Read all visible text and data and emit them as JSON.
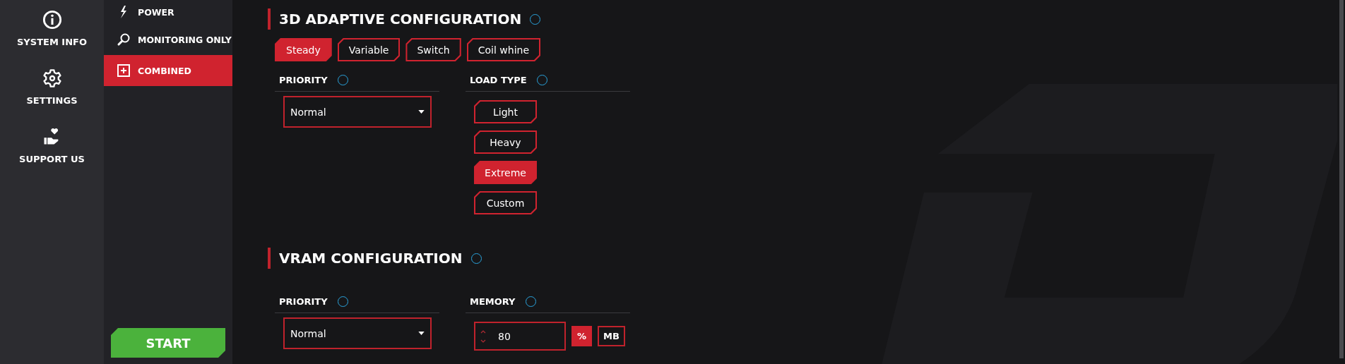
{
  "main_nav": [
    {
      "label": "SYSTEM INFO",
      "kind": "info"
    },
    {
      "label": "SETTINGS",
      "kind": "gear"
    },
    {
      "label": "SUPPORT US",
      "kind": "heart"
    }
  ],
  "test_nav": {
    "items": [
      {
        "label": "POWER",
        "kind": "bolt",
        "selected": false
      },
      {
        "label": "MONITORING ONLY",
        "kind": "search",
        "selected": false
      },
      {
        "label": "COMBINED",
        "kind": "plus",
        "selected": true
      }
    ],
    "start_button": "START"
  },
  "adaptive": {
    "title": "3D ADAPTIVE CONFIGURATION",
    "modes": [
      {
        "label": "Steady",
        "selected": true
      },
      {
        "label": "Variable",
        "selected": false
      },
      {
        "label": "Switch",
        "selected": false
      },
      {
        "label": "Coil whine",
        "selected": false
      }
    ],
    "priority": {
      "label": "PRIORITY",
      "value": "Normal"
    },
    "load_type": {
      "label": "LOAD TYPE",
      "options": [
        {
          "label": "Light",
          "selected": false
        },
        {
          "label": "Heavy",
          "selected": false
        },
        {
          "label": "Extreme",
          "selected": true
        },
        {
          "label": "Custom",
          "selected": false
        }
      ]
    }
  },
  "vram": {
    "title": "VRAM CONFIGURATION",
    "priority": {
      "label": "PRIORITY",
      "value": "Normal"
    },
    "memory": {
      "label": "MEMORY",
      "value": "80",
      "units": [
        {
          "label": "%",
          "selected": true
        },
        {
          "label": "MB",
          "selected": false
        }
      ]
    }
  }
}
